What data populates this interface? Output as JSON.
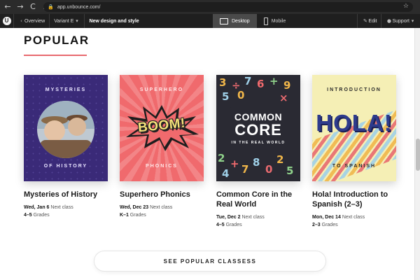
{
  "browser": {
    "url": "app.unbounce.com/",
    "back_glyph": "←",
    "forward_glyph": "→",
    "reload_glyph": "C",
    "home_glyph": "⌂",
    "lock_glyph": "🔒",
    "star_glyph": "☆"
  },
  "app_bar": {
    "logo_glyph": "U",
    "overview_label": "Overview",
    "variant_label": "Variant E",
    "page_name": "New design and style",
    "desktop_label": "Desktop",
    "mobile_label": "Mobile",
    "edit_label": "Edit",
    "support_label": "Support",
    "chevron_left_glyph": "‹",
    "dropdown_glyph": "▾",
    "edit_glyph": "✎",
    "support_glyph": "●"
  },
  "section": {
    "title": "POPULAR",
    "accent_color": "#e86a6f"
  },
  "cards": [
    {
      "cover_top": "MYSTERIES",
      "cover_bottom": "OF HISTORY",
      "title": "Mysteries of History",
      "date": "Wed, Jan 6",
      "date_suffix": "Next class",
      "grades": "4–5",
      "grades_suffix": "Grades"
    },
    {
      "cover_top": "SUPERHERO",
      "cover_word": "BOOM!",
      "cover_bottom": "PHONICS",
      "title": "Superhero Phonics",
      "date": "Wed, Dec 23",
      "date_suffix": "Next class",
      "grades": "K–1",
      "grades_suffix": "Grades"
    },
    {
      "cover_line1": "COMMON",
      "cover_line2": "CORE",
      "cover_sub": "IN THE REAL WORLD",
      "title": "Common Core in the Real World",
      "date": "Tue, Dec 2",
      "date_suffix": "Next class",
      "grades": "4–5",
      "grades_suffix": "Grades"
    },
    {
      "cover_top": "INTRODUCTION",
      "cover_word": "HOLA!",
      "cover_bottom": "TO SPANISH",
      "title": "Hola! Introduction to Spanish (2–3)",
      "date": "Mon, Dec 14",
      "date_suffix": "Next class",
      "grades": "2–3",
      "grades_suffix": "Grades"
    }
  ],
  "cta": {
    "label": "SEE POPULAR CLASSESS"
  }
}
